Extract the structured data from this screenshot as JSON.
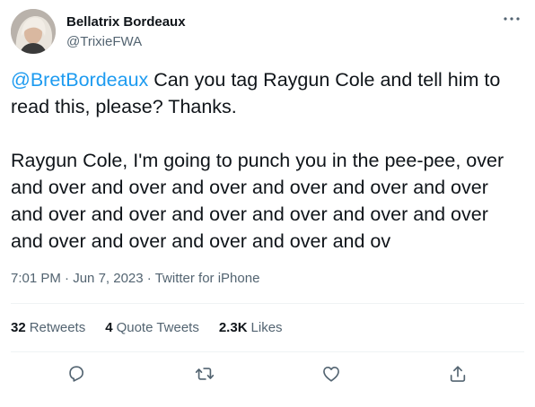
{
  "author": {
    "display_name": "Bellatrix Bordeaux",
    "handle": "@TrixieFWA"
  },
  "tweet": {
    "mention": "@BretBordeaux",
    "line1_rest": " Can you tag Raygun Cole and tell him to read this, please? Thanks.",
    "line2": "Raygun Cole, I'm going to punch you in the pee-pee, over and over and over and over and over and over and over and over and over and over and over and over and over and over and over and over and over and ov"
  },
  "meta": {
    "time": "7:01 PM",
    "separator": " · ",
    "date": "Jun 7, 2023",
    "source": "Twitter for iPhone"
  },
  "stats": {
    "retweets_count": "32",
    "retweets_label": "Retweets",
    "quotes_count": "4",
    "quotes_label": "Quote Tweets",
    "likes_count": "2.3K",
    "likes_label": "Likes"
  },
  "colors": {
    "link": "#1d9bf0",
    "secondary": "#536471",
    "text": "#0f1419",
    "divider": "#eff3f4"
  },
  "icons": {
    "more": "more-dots-icon",
    "reply": "reply-icon",
    "retweet": "retweet-icon",
    "like": "heart-icon",
    "share": "share-icon"
  }
}
